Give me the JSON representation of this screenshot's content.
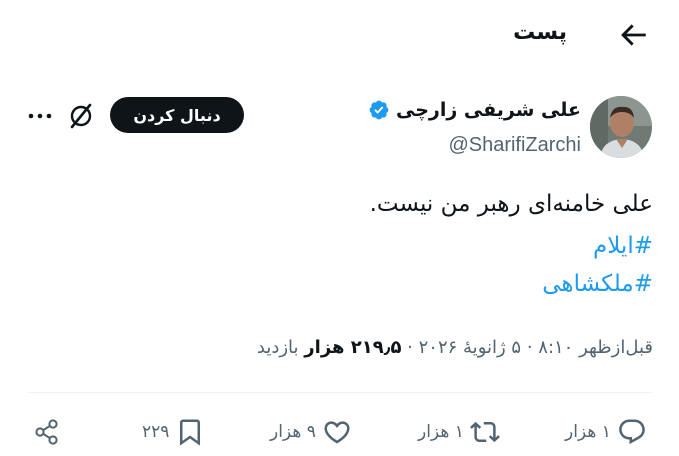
{
  "header": {
    "title": "پست",
    "back_icon": "arrow-left-icon"
  },
  "author": {
    "name": "علی شریفی زارچی",
    "handle": "@SharifiZarchi",
    "verified_color": "#1d9bf0"
  },
  "actions_top": {
    "follow_label": "دنبال کردن"
  },
  "tweet": {
    "text": "علی خامنه‌ای رهبر من نیست.",
    "hashtags": [
      "#ایلام",
      "#ملکشاهی"
    ],
    "time": "قبل‌ازظهر ۸:۱۰",
    "date": "۵ ژانویهٔ ۲۰۲۶",
    "views_value": "۲۱۹٫۵ هزار",
    "views_label": "بازدید"
  },
  "engagement": {
    "replies": "۱ هزار",
    "retweets": "۱ هزار",
    "likes": "۹ هزار",
    "bookmarks": "۲۲۹"
  },
  "colors": {
    "accent": "#1d9bf0",
    "text": "#0f1419",
    "muted": "#536471"
  }
}
